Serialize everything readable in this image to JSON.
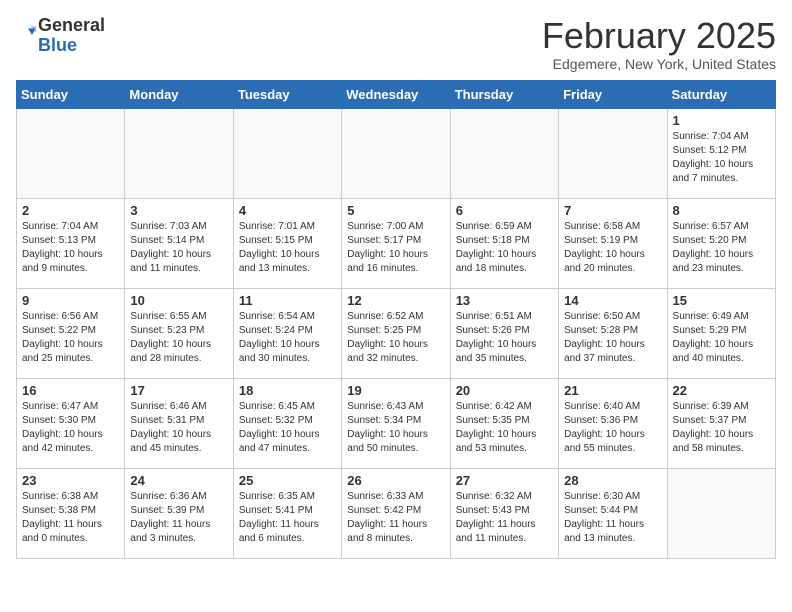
{
  "logo": {
    "general": "General",
    "blue": "Blue"
  },
  "title": "February 2025",
  "subtitle": "Edgemere, New York, United States",
  "days_header": [
    "Sunday",
    "Monday",
    "Tuesday",
    "Wednesday",
    "Thursday",
    "Friday",
    "Saturday"
  ],
  "weeks": [
    [
      {
        "day": "",
        "info": ""
      },
      {
        "day": "",
        "info": ""
      },
      {
        "day": "",
        "info": ""
      },
      {
        "day": "",
        "info": ""
      },
      {
        "day": "",
        "info": ""
      },
      {
        "day": "",
        "info": ""
      },
      {
        "day": "1",
        "info": "Sunrise: 7:04 AM\nSunset: 5:12 PM\nDaylight: 10 hours and 7 minutes."
      }
    ],
    [
      {
        "day": "2",
        "info": "Sunrise: 7:04 AM\nSunset: 5:13 PM\nDaylight: 10 hours and 9 minutes."
      },
      {
        "day": "3",
        "info": "Sunrise: 7:03 AM\nSunset: 5:14 PM\nDaylight: 10 hours and 11 minutes."
      },
      {
        "day": "4",
        "info": "Sunrise: 7:01 AM\nSunset: 5:15 PM\nDaylight: 10 hours and 13 minutes."
      },
      {
        "day": "5",
        "info": "Sunrise: 7:00 AM\nSunset: 5:17 PM\nDaylight: 10 hours and 16 minutes."
      },
      {
        "day": "6",
        "info": "Sunrise: 6:59 AM\nSunset: 5:18 PM\nDaylight: 10 hours and 18 minutes."
      },
      {
        "day": "7",
        "info": "Sunrise: 6:58 AM\nSunset: 5:19 PM\nDaylight: 10 hours and 20 minutes."
      },
      {
        "day": "8",
        "info": "Sunrise: 6:57 AM\nSunset: 5:20 PM\nDaylight: 10 hours and 23 minutes."
      }
    ],
    [
      {
        "day": "9",
        "info": "Sunrise: 6:56 AM\nSunset: 5:22 PM\nDaylight: 10 hours and 25 minutes."
      },
      {
        "day": "10",
        "info": "Sunrise: 6:55 AM\nSunset: 5:23 PM\nDaylight: 10 hours and 28 minutes."
      },
      {
        "day": "11",
        "info": "Sunrise: 6:54 AM\nSunset: 5:24 PM\nDaylight: 10 hours and 30 minutes."
      },
      {
        "day": "12",
        "info": "Sunrise: 6:52 AM\nSunset: 5:25 PM\nDaylight: 10 hours and 32 minutes."
      },
      {
        "day": "13",
        "info": "Sunrise: 6:51 AM\nSunset: 5:26 PM\nDaylight: 10 hours and 35 minutes."
      },
      {
        "day": "14",
        "info": "Sunrise: 6:50 AM\nSunset: 5:28 PM\nDaylight: 10 hours and 37 minutes."
      },
      {
        "day": "15",
        "info": "Sunrise: 6:49 AM\nSunset: 5:29 PM\nDaylight: 10 hours and 40 minutes."
      }
    ],
    [
      {
        "day": "16",
        "info": "Sunrise: 6:47 AM\nSunset: 5:30 PM\nDaylight: 10 hours and 42 minutes."
      },
      {
        "day": "17",
        "info": "Sunrise: 6:46 AM\nSunset: 5:31 PM\nDaylight: 10 hours and 45 minutes."
      },
      {
        "day": "18",
        "info": "Sunrise: 6:45 AM\nSunset: 5:32 PM\nDaylight: 10 hours and 47 minutes."
      },
      {
        "day": "19",
        "info": "Sunrise: 6:43 AM\nSunset: 5:34 PM\nDaylight: 10 hours and 50 minutes."
      },
      {
        "day": "20",
        "info": "Sunrise: 6:42 AM\nSunset: 5:35 PM\nDaylight: 10 hours and 53 minutes."
      },
      {
        "day": "21",
        "info": "Sunrise: 6:40 AM\nSunset: 5:36 PM\nDaylight: 10 hours and 55 minutes."
      },
      {
        "day": "22",
        "info": "Sunrise: 6:39 AM\nSunset: 5:37 PM\nDaylight: 10 hours and 58 minutes."
      }
    ],
    [
      {
        "day": "23",
        "info": "Sunrise: 6:38 AM\nSunset: 5:38 PM\nDaylight: 11 hours and 0 minutes."
      },
      {
        "day": "24",
        "info": "Sunrise: 6:36 AM\nSunset: 5:39 PM\nDaylight: 11 hours and 3 minutes."
      },
      {
        "day": "25",
        "info": "Sunrise: 6:35 AM\nSunset: 5:41 PM\nDaylight: 11 hours and 6 minutes."
      },
      {
        "day": "26",
        "info": "Sunrise: 6:33 AM\nSunset: 5:42 PM\nDaylight: 11 hours and 8 minutes."
      },
      {
        "day": "27",
        "info": "Sunrise: 6:32 AM\nSunset: 5:43 PM\nDaylight: 11 hours and 11 minutes."
      },
      {
        "day": "28",
        "info": "Sunrise: 6:30 AM\nSunset: 5:44 PM\nDaylight: 11 hours and 13 minutes."
      },
      {
        "day": "",
        "info": ""
      }
    ]
  ]
}
